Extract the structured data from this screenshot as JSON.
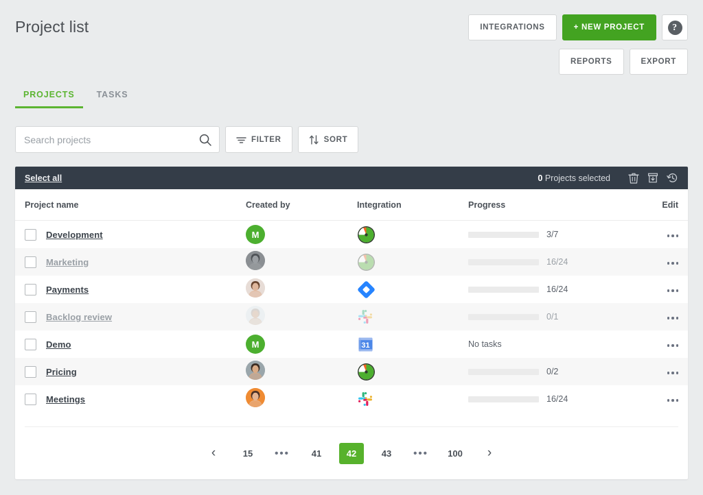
{
  "header": {
    "title": "Project list",
    "buttons": {
      "integrations": "INTEGRATIONS",
      "new_project": "+ NEW PROJECT",
      "help": "?",
      "reports": "REPORTS",
      "export": "EXPORT"
    }
  },
  "tabs": [
    {
      "label": "PROJECTS",
      "active": true
    },
    {
      "label": "TASKS",
      "active": false
    }
  ],
  "toolbar": {
    "search_placeholder": "Search projects",
    "search_value": "",
    "filter_label": "FILTER",
    "sort_label": "SORT"
  },
  "select_bar": {
    "select_all": "Select all",
    "count": "0",
    "count_suffix": "Projects selected",
    "icons": [
      "trash-icon",
      "archive-icon",
      "restore-history-icon"
    ]
  },
  "table": {
    "columns": [
      "Project name",
      "Created by",
      "Integration",
      "Progress",
      "Edit"
    ],
    "rows": [
      {
        "name": "Development",
        "muted": false,
        "avatar": "initial-m-green",
        "integration": "clockify-icon",
        "progress_text": "3/7",
        "percent": 43,
        "bar": "green",
        "has_bar": true
      },
      {
        "name": "Marketing",
        "muted": true,
        "avatar": "photo-woman-gray",
        "integration": "clockify-icon-faded",
        "progress_text": "16/24",
        "percent": 67,
        "bar": "pale",
        "has_bar": true
      },
      {
        "name": "Payments",
        "muted": false,
        "avatar": "photo-woman-1",
        "integration": "jira-icon",
        "progress_text": "16/24",
        "percent": 67,
        "bar": "green",
        "has_bar": true
      },
      {
        "name": "Backlog review",
        "muted": true,
        "avatar": "photo-man-faded",
        "integration": "slack-icon-faded",
        "progress_text": "0/1",
        "percent": 0,
        "bar": "green",
        "has_bar": true
      },
      {
        "name": "Demo",
        "muted": false,
        "avatar": "initial-m-green",
        "integration": "google-calendar-icon",
        "progress_text": "No tasks",
        "percent": 0,
        "bar": "green",
        "has_bar": false
      },
      {
        "name": "Pricing",
        "muted": false,
        "avatar": "photo-man-1",
        "integration": "clockify-icon",
        "progress_text": "0/2",
        "percent": 0,
        "bar": "green",
        "has_bar": true
      },
      {
        "name": "Meetings",
        "muted": false,
        "avatar": "photo-woman-2",
        "integration": "slack-icon",
        "progress_text": "16/24",
        "percent": 67,
        "bar": "green",
        "has_bar": true
      }
    ],
    "row_menu_icon": "ellipsis-icon"
  },
  "pagination": {
    "prev": "‹",
    "next": "›",
    "items": [
      "15",
      "•••",
      "41",
      "42",
      "43",
      "•••",
      "100"
    ],
    "current": "42"
  },
  "colors": {
    "accent_green": "#57b22c",
    "button_green": "#43a321",
    "dark_bar": "#343d48",
    "page_bg": "#eaeced",
    "row_alt": "#f7f7f7"
  }
}
